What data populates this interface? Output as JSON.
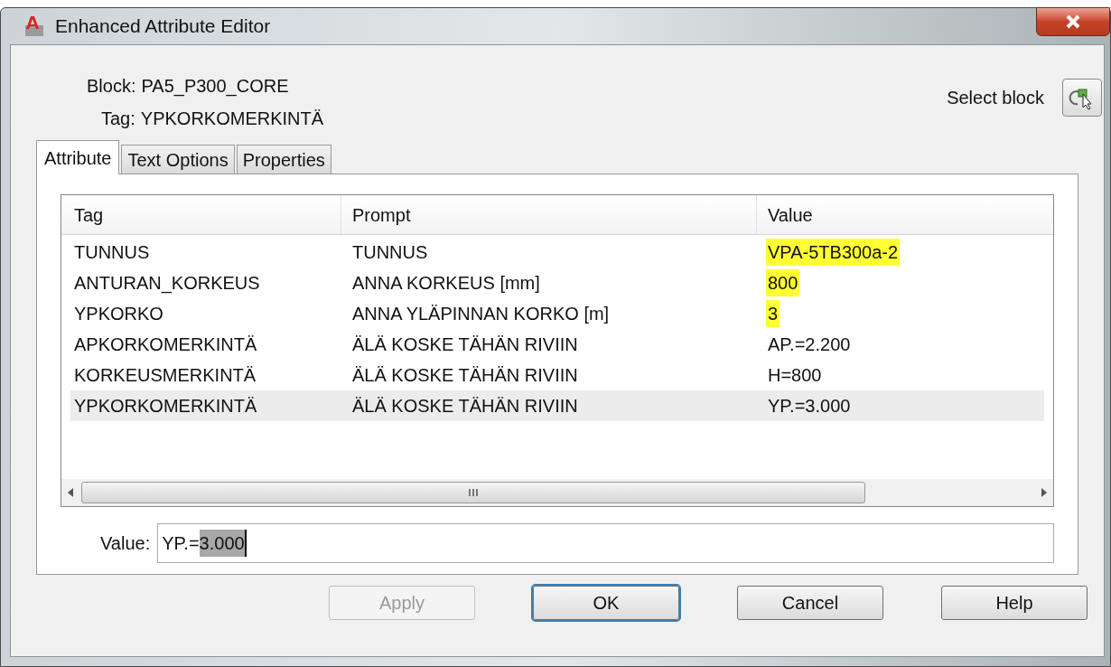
{
  "window": {
    "title": "Enhanced Attribute Editor"
  },
  "block": {
    "label": "Block:",
    "value": "PA5_P300_CORE"
  },
  "tag": {
    "label": "Tag:",
    "value": "YPKORKOMERKINTÄ"
  },
  "select_block": {
    "label": "Select block"
  },
  "tabs": [
    {
      "label": "Attribute",
      "selected": true
    },
    {
      "label": "Text Options",
      "selected": false
    },
    {
      "label": "Properties",
      "selected": false
    }
  ],
  "table": {
    "columns": [
      "Tag",
      "Prompt",
      "Value"
    ],
    "rows": [
      {
        "tag": "TUNNUS",
        "prompt": "TUNNUS",
        "value": "VPA-5TB300a-2",
        "highlighted": true,
        "selected": false
      },
      {
        "tag": "ANTURAN_KORKEUS",
        "prompt": "ANNA KORKEUS [mm]",
        "value": "800",
        "highlighted": true,
        "selected": false
      },
      {
        "tag": "YPKORKO",
        "prompt": "ANNA YLÄPINNAN KORKO [m]",
        "value": "3",
        "highlighted": true,
        "selected": false
      },
      {
        "tag": "APKORKOMERKINTÄ",
        "prompt": "ÄLÄ KOSKE TÄHÄN RIVIIN",
        "value": "AP.=2.200",
        "highlighted": false,
        "selected": false
      },
      {
        "tag": "KORKEUSMERKINTÄ",
        "prompt": "ÄLÄ KOSKE TÄHÄN RIVIIN",
        "value": "H=800",
        "highlighted": false,
        "selected": false
      },
      {
        "tag": "YPKORKOMERKINTÄ",
        "prompt": "ÄLÄ KOSKE TÄHÄN RIVIIN",
        "value": "YP.=3.000",
        "highlighted": false,
        "selected": true
      }
    ]
  },
  "value_field": {
    "label": "Value:",
    "text": "YP.=",
    "selected_text": "3.000"
  },
  "buttons": [
    {
      "label": "Apply",
      "disabled": true,
      "default": false
    },
    {
      "label": "OK",
      "disabled": false,
      "default": true
    },
    {
      "label": "Cancel",
      "disabled": false,
      "default": false
    },
    {
      "label": "Help",
      "disabled": false,
      "default": false
    }
  ]
}
